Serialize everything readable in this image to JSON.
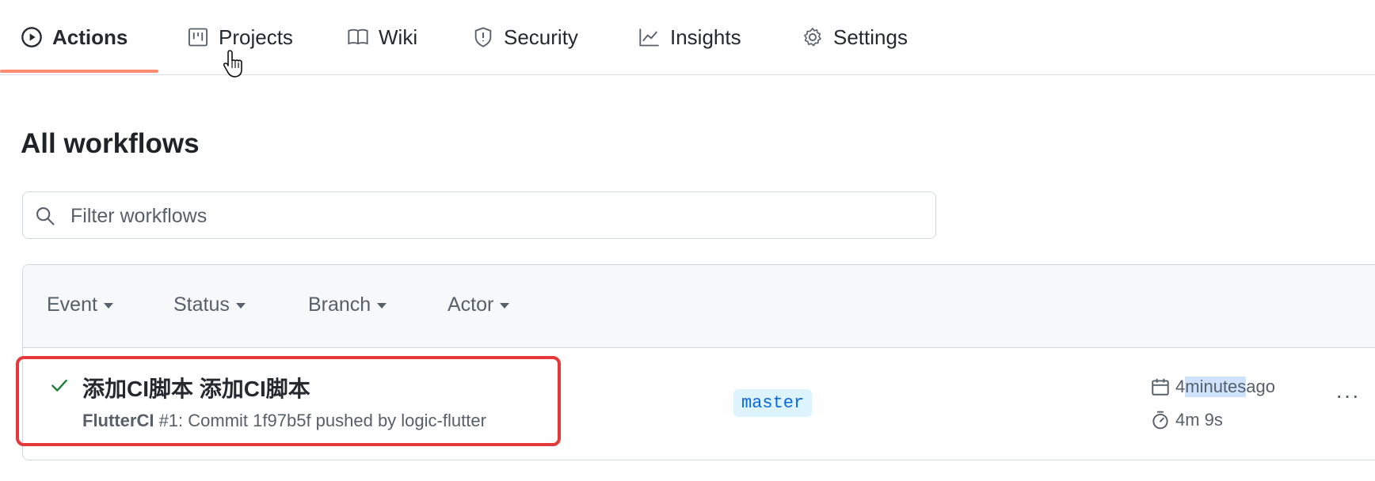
{
  "nav": {
    "tabs": [
      {
        "label": "Actions",
        "icon": "play-icon",
        "active": true
      },
      {
        "label": "Projects",
        "icon": "project-board-icon"
      },
      {
        "label": "Wiki",
        "icon": "book-icon"
      },
      {
        "label": "Security",
        "icon": "shield-icon"
      },
      {
        "label": "Insights",
        "icon": "graph-icon"
      },
      {
        "label": "Settings",
        "icon": "gear-icon"
      }
    ],
    "active_underline_color": "#fd8c73"
  },
  "page": {
    "title": "All workflows"
  },
  "filter": {
    "placeholder": "Filter workflows",
    "value": ""
  },
  "run_filters": [
    {
      "label": "Event"
    },
    {
      "label": "Status"
    },
    {
      "label": "Branch"
    },
    {
      "label": "Actor"
    }
  ],
  "runs": [
    {
      "status": "success",
      "status_icon": "check-icon",
      "title": "添加CI脚本 添加CI脚本",
      "workflow": "FlutterCI",
      "meta_rest": " #1: Commit 1f97b5f pushed by logic-flutter",
      "branch": "master",
      "time_prefix": "4 ",
      "time_highlight": "minutes",
      "time_suffix": " ago",
      "duration": "4m 9s",
      "more_label": "···"
    }
  ],
  "colors": {
    "success": "#1a7f37",
    "annotation": "#e5383b",
    "branch_bg": "#ddf4ff",
    "branch_fg": "#0969da"
  }
}
